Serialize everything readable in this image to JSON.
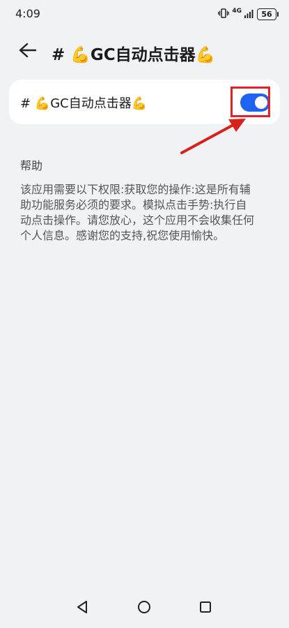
{
  "status_bar": {
    "time": "4:09",
    "network": "4G",
    "battery": "56"
  },
  "header": {
    "title": "# 💪GC自动点击器💪",
    "back_icon": "arrow-left-icon"
  },
  "setting": {
    "label": "# 💪GC自动点击器💪",
    "enabled": true,
    "toggle_color": "#1e64f0",
    "highlight_color": "#e0232b"
  },
  "help": {
    "title": "帮助",
    "text": "该应用需要以下权限:获取您的操作:这是所有辅助功能服务必须的要求。模拟点击手势:执行自动点击操作。请您放心，这个应用不会收集任何个人信息。感谢您的支持,祝您使用愉快。"
  },
  "nav_bar": {
    "back_icon": "triangle-back-icon",
    "home_icon": "circle-home-icon",
    "recents_icon": "square-recents-icon"
  }
}
